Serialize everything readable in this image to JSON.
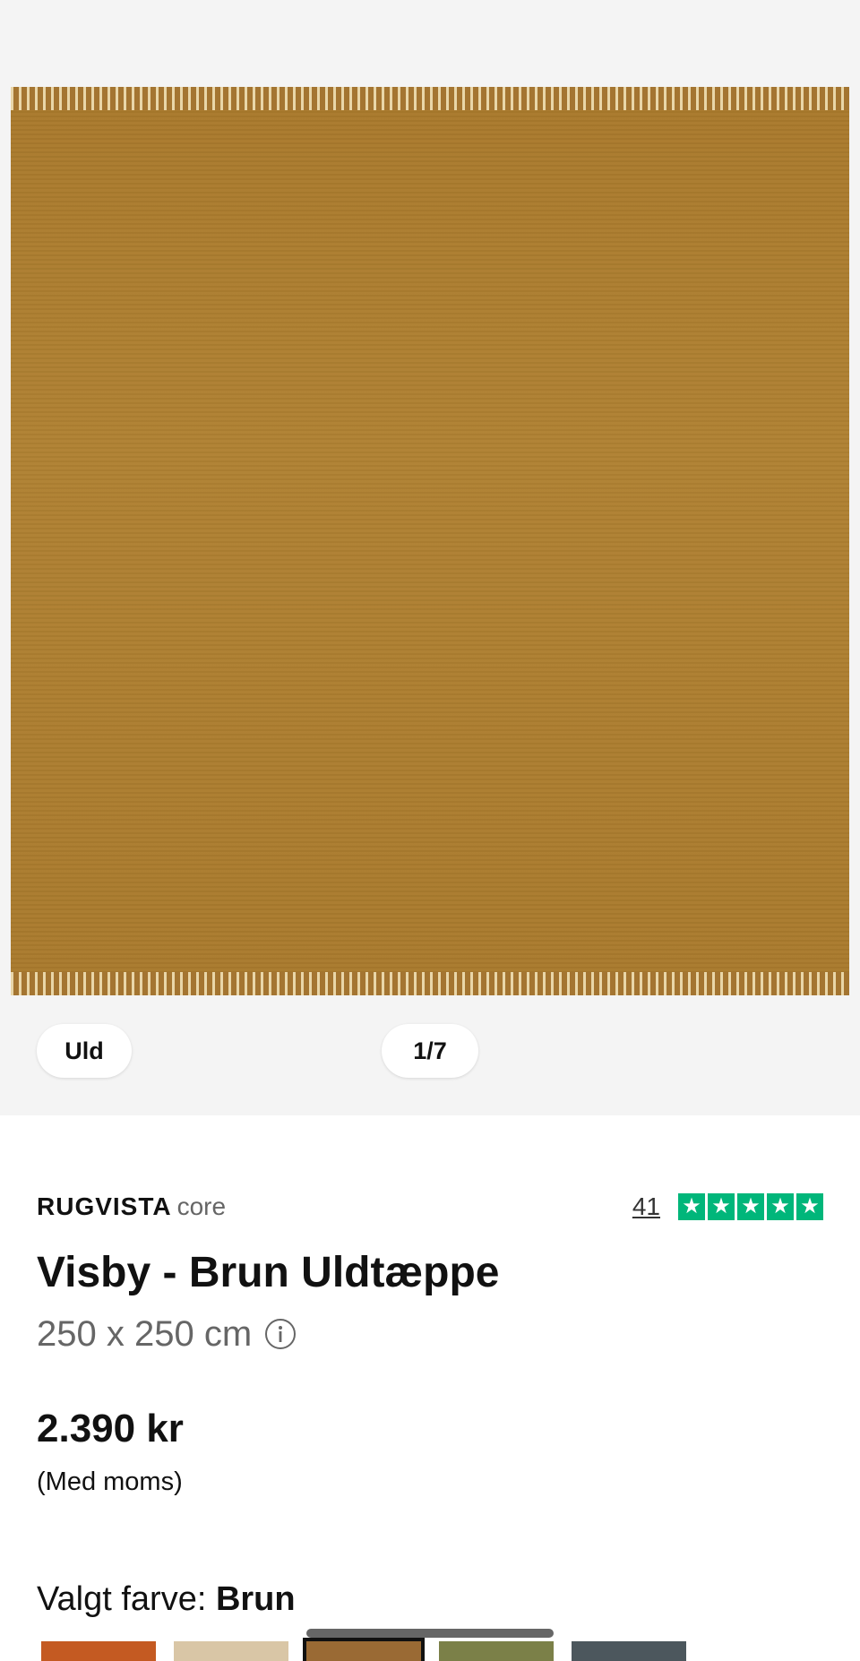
{
  "gallery": {
    "material_tag": "Uld",
    "image_counter": "1/7"
  },
  "product": {
    "brand": "RUGVISTA",
    "brand_line": "core",
    "review_count": "41",
    "rating_stars": 5,
    "title": "Visby - Brun Uldtæppe",
    "size": "250 x 250 cm",
    "price": "2.390 kr",
    "vat_note": "(Med moms)",
    "color_label": "Valgt farve:",
    "color_value": "Brun"
  },
  "colors": {
    "trustpilot_green": "#00b67a",
    "rug_main": "#ad7d2f",
    "swatches": [
      "#c45a22",
      "#d9c6a6",
      "#9a6a34",
      "#7b8048",
      "#4c575d"
    ],
    "selected_swatch_index": 2
  },
  "icons": {
    "info": "info-icon",
    "star": "star-icon"
  }
}
